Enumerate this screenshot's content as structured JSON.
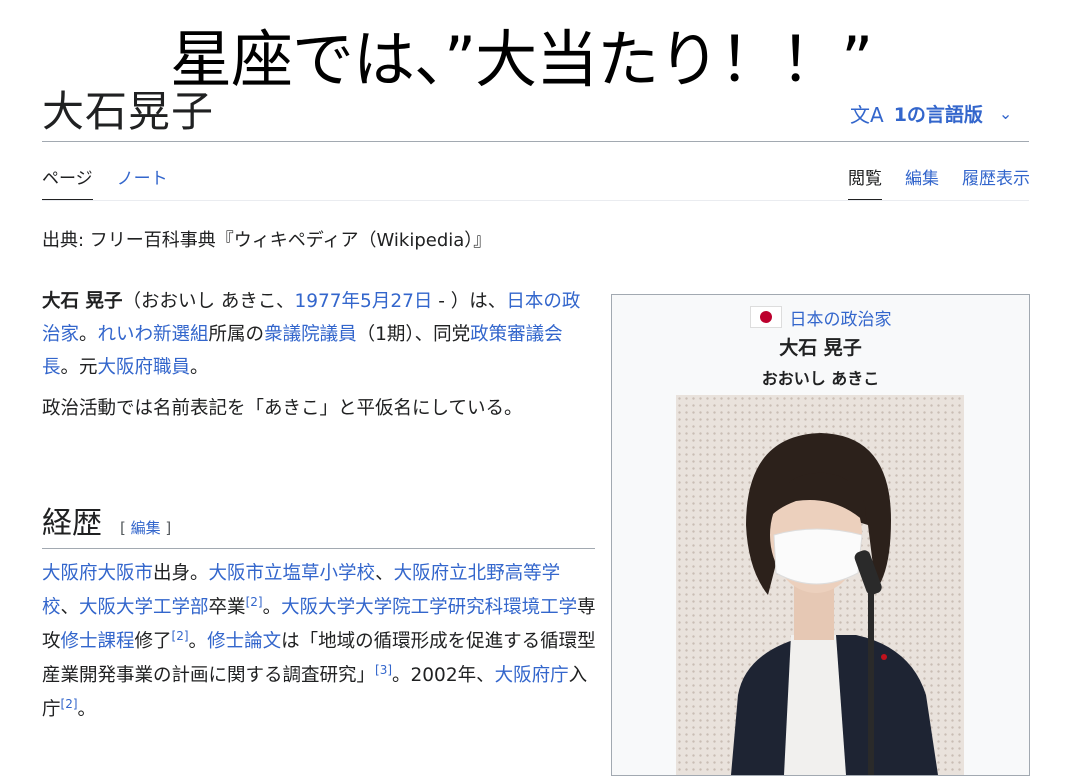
{
  "caption": "星座では、”大当たり！！”",
  "page": {
    "title": "大石晃子",
    "languages_label": "1の言語版",
    "languages_icon": "translate-icon"
  },
  "tabs": {
    "left": [
      "ページ",
      "ノート"
    ],
    "right": [
      "閲覧",
      "編集",
      "履歴表示"
    ]
  },
  "source_line": "出典: フリー百科事典『ウィキペディア（Wikipedia）』",
  "lead": {
    "p1": {
      "name": "大石 晃子",
      "t1": "（おおいし あきこ、",
      "birth_link": "1977年5月27日",
      "t2": " - ）は、",
      "l_japan_pol": "日本の政治家",
      "t3": "。",
      "l_party": "れいわ新選組",
      "t4": "所属の",
      "l_rep": "衆議院議員",
      "t5": "（1期）、同党",
      "l_policy": "政策審議会長",
      "t6": "。元",
      "l_osaka_staff": "大阪府職員",
      "t7": "。"
    },
    "p2": "政治活動では名前表記を「あきこ」と平仮名にしている。"
  },
  "section": {
    "heading": "経歴",
    "edit_open": "[ ",
    "edit_label": "編集",
    "edit_close": " ]"
  },
  "career": {
    "l_osaka_pref": "大阪府",
    "l_osaka_city": "大阪市",
    "t1": "出身。",
    "l_elem": "大阪市立塩草小学校",
    "t2": "、",
    "l_high": "大阪府立北野高等学校",
    "t3": "、",
    "l_univ": "大阪大学工学部",
    "t4": "卒業",
    "ref2a": "[2]",
    "t5": "。",
    "l_grad": "大阪大学大学院工学研究科環境工学",
    "t6": "専攻",
    "l_master": "修士課程",
    "t7": "修了",
    "ref2b": "[2]",
    "t8": "。",
    "l_thesis": "修士論文",
    "t9": "は「地域の循環形成を促進する循環型産業開発事業の計画に関する調査研究」",
    "ref3": "[3]",
    "t10": "。2002年、",
    "l_office": "大阪府庁",
    "t11": "入庁",
    "ref2c": "[2]",
    "t12": "。"
  },
  "infobox": {
    "role": "日本の政治家",
    "name": "大石 晃子",
    "reading": "おおいし あきこ"
  },
  "colors": {
    "link": "#3366cc",
    "text": "#202122",
    "rule": "#a2a9b1",
    "flag_red": "#bc002d"
  }
}
